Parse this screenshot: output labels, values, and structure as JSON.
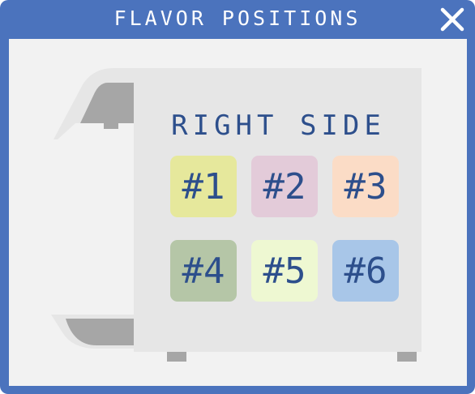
{
  "window": {
    "title": "FLAVOR POSITIONS",
    "close_icon": "close-icon",
    "frame_color": "#4b73bd"
  },
  "machine": {
    "side_label": "RIGHT SIDE",
    "body_color": "#e6e6e6",
    "accent_color": "#a6a6a6",
    "text_color": "#2d4f8c"
  },
  "flavors": [
    {
      "label": "#1",
      "color": "#e6e89c"
    },
    {
      "label": "#2",
      "color": "#e3cbd9"
    },
    {
      "label": "#3",
      "color": "#fbdcc6"
    },
    {
      "label": "#4",
      "color": "#b5c6a7"
    },
    {
      "label": "#5",
      "color": "#eef8d2"
    },
    {
      "label": "#6",
      "color": "#a8c6e8"
    }
  ]
}
